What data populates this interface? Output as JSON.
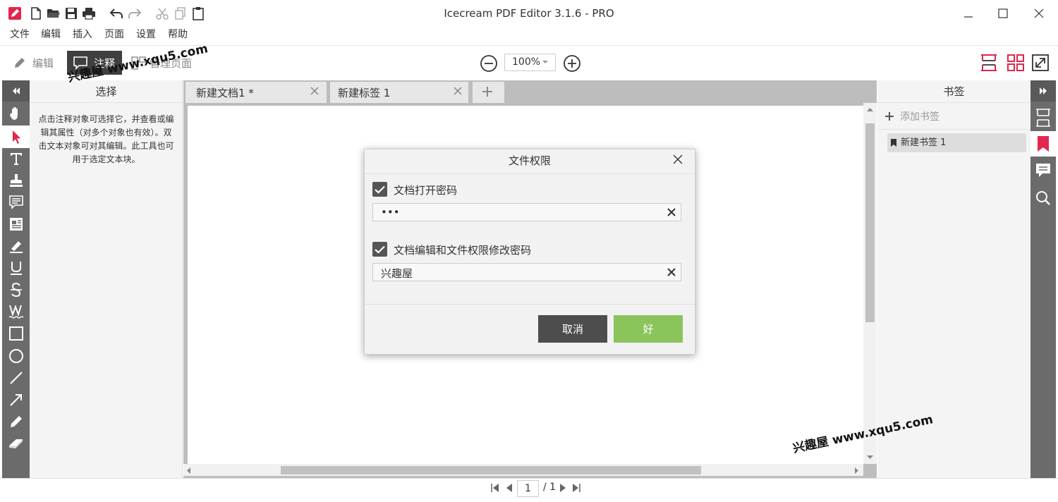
{
  "window": {
    "title": "Icecream PDF Editor 3.1.6 - PRO"
  },
  "menu": [
    "文件",
    "编辑",
    "插入",
    "页面",
    "设置",
    "帮助"
  ],
  "toolbar": {
    "modes": {
      "edit": "编辑",
      "annotate": "注释",
      "manage_pages": "管理页面"
    },
    "zoom_value": "100%"
  },
  "left_panel": {
    "title": "选择",
    "description": "点击注释对象可选择它，并查看或编辑其属性（对多个对象也有效）。双击文本对象可对其编辑。此工具也可用于选定文本块。"
  },
  "tabs": [
    {
      "label": "新建文档1 *"
    },
    {
      "label": "新建标签 1"
    }
  ],
  "right_panel": {
    "title": "书签",
    "add_label": "添加书签",
    "bookmarks": [
      "新建书签 1"
    ]
  },
  "dialog": {
    "title": "文件权限",
    "open_password": {
      "label": "文档打开密码",
      "checked": true,
      "value": "•••"
    },
    "edit_password": {
      "label": "文档编辑和文件权限修改密码",
      "checked": true,
      "value": "兴趣屋"
    },
    "cancel_label": "取消",
    "ok_label": "好"
  },
  "pager": {
    "current": "1",
    "total_text": "/ 1"
  },
  "watermarks": [
    "兴趣屋 www.xqu5.com",
    "兴趣屋 www.xqu5.com"
  ],
  "colors": {
    "accent_red": "#e2264d",
    "ok_green": "#8bc45b",
    "toolbar_dark": "#6b6b6b"
  }
}
